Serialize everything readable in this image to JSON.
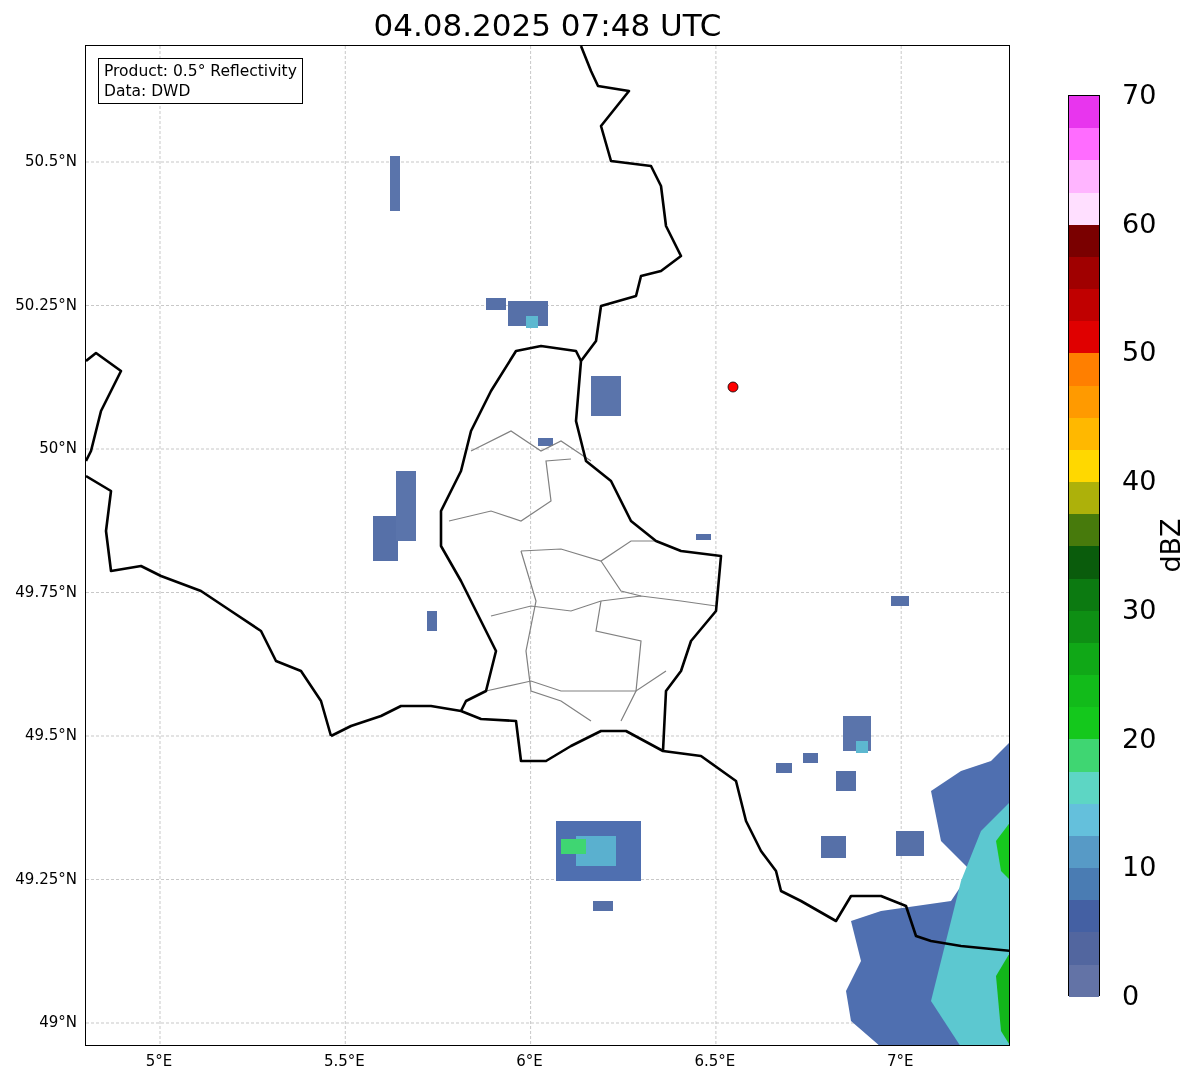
{
  "title": "04.08.2025 07:48 UTC",
  "info_box": {
    "lines": [
      "Product: 0.5° Reflectivity",
      "Data: DWD"
    ]
  },
  "map": {
    "y_ticks": [
      "50.5°N",
      "50.25°N",
      "50°N",
      "49.75°N",
      "49.5°N",
      "49.25°N",
      "49°N"
    ],
    "x_ticks": [
      "5°E",
      "5.5°E",
      "6°E",
      "6.5°E",
      "7°E"
    ]
  },
  "colorbar": {
    "label": "dBZ",
    "ticks": [
      "70",
      "60",
      "50",
      "40",
      "30",
      "20",
      "10",
      "0"
    ],
    "bins": [
      {
        "color": "#6373a6"
      },
      {
        "color": "#52669f"
      },
      {
        "color": "#4460a3"
      },
      {
        "color": "#4a7cb3"
      },
      {
        "color": "#579ac6"
      },
      {
        "color": "#64c0dc"
      },
      {
        "color": "#5dd6c4"
      },
      {
        "color": "#3fd672"
      },
      {
        "color": "#14c81c"
      },
      {
        "color": "#12bb1a"
      },
      {
        "color": "#10a817"
      },
      {
        "color": "#0e8f14"
      },
      {
        "color": "#0c7a11"
      },
      {
        "color": "#0a5c0c"
      },
      {
        "color": "#477a0c"
      },
      {
        "color": "#adb10a"
      },
      {
        "color": "#ffd800"
      },
      {
        "color": "#ffb800"
      },
      {
        "color": "#ff9a00"
      },
      {
        "color": "#ff7f00"
      },
      {
        "color": "#e00000"
      },
      {
        "color": "#c00000"
      },
      {
        "color": "#a00000"
      },
      {
        "color": "#7a0000"
      },
      {
        "color": "#ffdfff"
      },
      {
        "color": "#ffb5ff"
      },
      {
        "color": "#ff6cff"
      },
      {
        "color": "#e835ee"
      }
    ]
  }
}
